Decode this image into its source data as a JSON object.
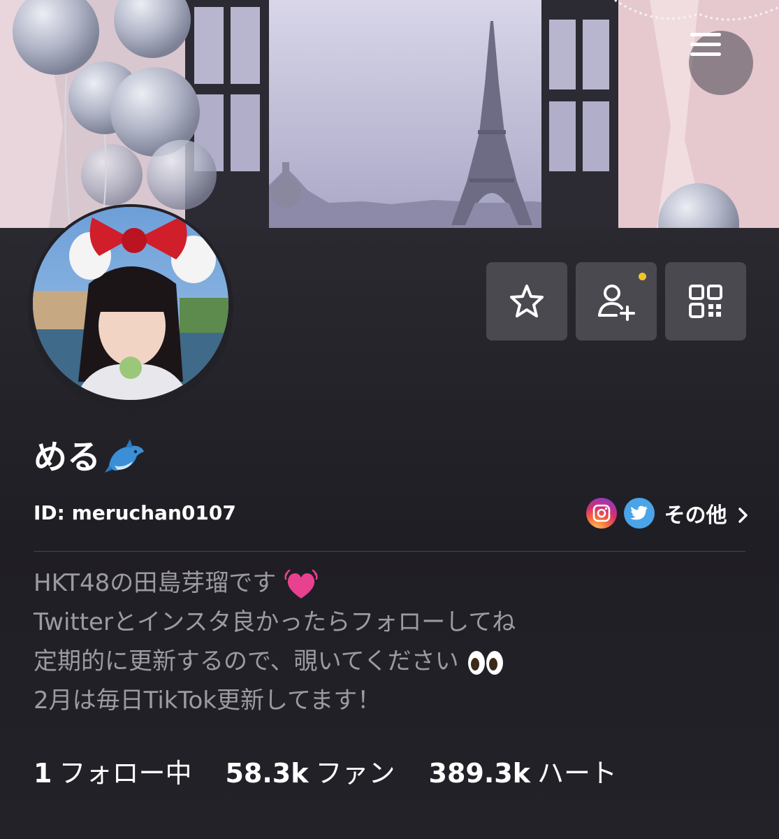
{
  "profile": {
    "name": "める",
    "name_emoji": "dolphin-emoji",
    "id_text": "ID: meruchan0107"
  },
  "social": {
    "instagram_icon": "instagram-icon",
    "twitter_icon": "twitter-icon",
    "more_label": "その他"
  },
  "bio": {
    "line1": "HKT48の田島芽瑠です",
    "line2": "Twitterとインスタ良かったらフォローしてね",
    "line3": "定期的に更新するので、覗いてください",
    "line4": "2月は毎日TikTok更新してます！"
  },
  "stats": {
    "following_count": "1",
    "following_label": "フォロー中",
    "fans_count": "58.3k",
    "fans_label": "ファン",
    "hearts_count": "389.3k",
    "hearts_label": "ハート"
  },
  "actions": {
    "favorite_icon": "star-icon",
    "add_friend_icon": "add-user-icon",
    "qr_icon": "qr-code-icon",
    "menu_icon": "hamburger-menu-icon"
  },
  "colors": {
    "background": "#222128",
    "button_bg": "#4a4950",
    "notify_dot": "#f0c52a",
    "bio_text": "#9c9ba1",
    "twitter": "#4aa4e8"
  }
}
